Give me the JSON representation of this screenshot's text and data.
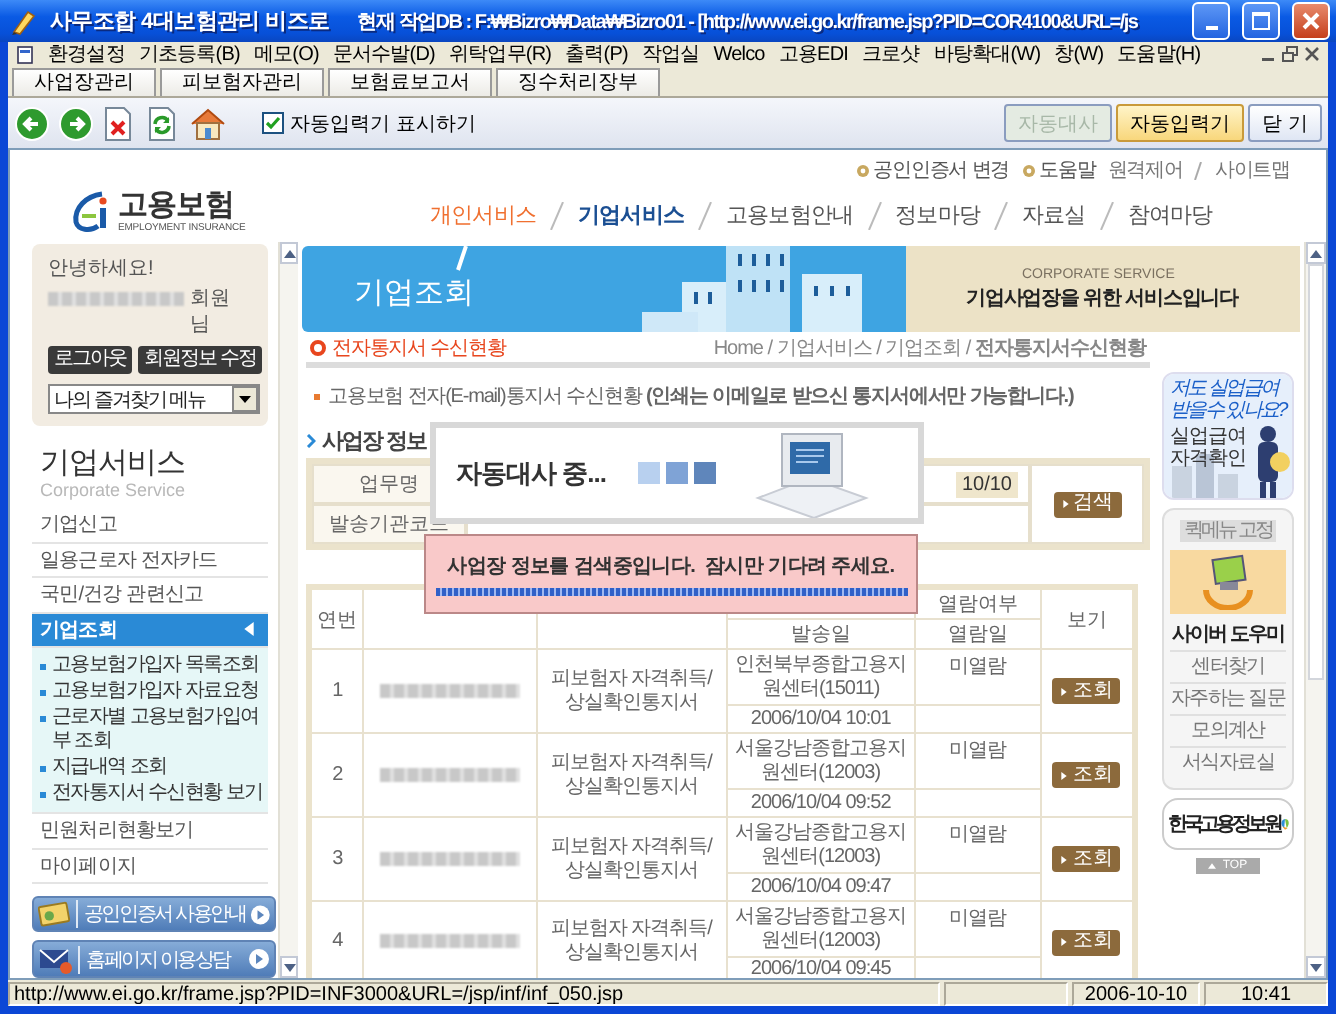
{
  "window": {
    "title": "사무조합 4대보험관리 비즈로",
    "subtitle": "현재 작업DB : F:₩Bizro₩Data₩Bizro01 - [http://www.ei.go.kr/frame.jsp?PID=COR4100&URL=/js"
  },
  "menu": [
    "환경설정",
    "기초등록(B)",
    "메모(O)",
    "문서수발(D)",
    "위탁업무(R)",
    "출력(P)",
    "작업실",
    "Welco",
    "고용EDI",
    "크로샷",
    "바탕확대(W)",
    "창(W)",
    "도움말(H)"
  ],
  "tabs": [
    {
      "label": "사업장관리",
      "selected": false
    },
    {
      "label": "피보험자관리",
      "selected": false
    },
    {
      "label": "보험료보고서",
      "selected": false
    },
    {
      "label": "징수처리장부",
      "selected": false
    }
  ],
  "toolbar": {
    "checkbox": {
      "label": "자동입력기 표시하기",
      "checked": true
    },
    "buttons": [
      {
        "label": "자동대사",
        "disabled": true,
        "highlighted": false
      },
      {
        "label": "자동입력기",
        "disabled": false,
        "highlighted": true
      },
      {
        "label": "닫 기",
        "disabled": false,
        "highlighted": false
      }
    ]
  },
  "site": {
    "top_links": [
      "공인인증서 변경",
      "도움말"
    ],
    "util_links": [
      "원격제어",
      "사이트맵"
    ],
    "logo": {
      "name": "고용보험",
      "subtitle": "EMPLOYMENT INSURANCE"
    },
    "nav": [
      {
        "label": "개인서비스",
        "selected": false,
        "accent": true
      },
      {
        "label": "기업서비스",
        "selected": true,
        "accent": false
      },
      {
        "label": "고용보험안내",
        "selected": false,
        "accent": false
      },
      {
        "label": "정보마당",
        "selected": false,
        "accent": false
      },
      {
        "label": "자료실",
        "selected": false,
        "accent": false
      },
      {
        "label": "참여마당",
        "selected": false,
        "accent": false
      }
    ]
  },
  "sidebar": {
    "login": {
      "greeting": "안녕하세요!",
      "suffix": "회원님",
      "buttons": [
        "로그아웃",
        "회원정보 수정"
      ],
      "favorites": "나의 즐겨찾기 메뉴"
    },
    "title": "기업서비스",
    "subtitle": "Corporate Service",
    "menu": [
      {
        "label": "기업신고",
        "selected": false
      },
      {
        "label": "일용근로자 전자카드",
        "selected": false
      },
      {
        "label": "국민/건강 관련신고",
        "selected": false
      },
      {
        "label": "기업조회",
        "selected": true,
        "children": [
          "고용보험가입자 목록조회",
          "고용보험가입자 자료요청",
          "근로자별 고용보험가입여부 조회",
          "지급내역 조회",
          "전자통지서 수신현황 보기"
        ]
      },
      {
        "label": "민원처리현황보기",
        "selected": false
      },
      {
        "label": "마이페이지",
        "selected": false
      }
    ],
    "buttons": [
      "공인인증서 사용안내",
      "홈페이지 이용상담"
    ]
  },
  "banner": {
    "title": "기업조회",
    "eyebrow": "CORPORATE SERVICE",
    "tagline": "기업사업장을 위한 서비스입니다"
  },
  "page_title": "전자통지서 수신현황",
  "breadcrumb": "Home / 기업서비스 / 기업조회 / **전자통지서수신현황**",
  "notice": "고용보험 전자(E-mail)통지서 수신현황 **(인쇄는 이메일로 받으신 통지서에서만 가능합니다.)**",
  "section_title": "사업장 정보",
  "info_table": {
    "rows": [
      {
        "header": "업무명",
        "value": "10/10"
      },
      {
        "header": "발송기관코드"
      }
    ],
    "button": "검색"
  },
  "table": {
    "header": {
      "number": "연번",
      "sent_date": "발송일",
      "read_status": "열람여부",
      "read_date": "열람일",
      "view": "보기"
    },
    "rows": [
      {
        "number": "1",
        "type": "피보험자 자격취득/상실확인통지서",
        "agency": "인천북부종합고용지원센터(15011)",
        "sent": "2006/10/04 10:01",
        "status": "미열람",
        "button": "조회"
      },
      {
        "number": "2",
        "type": "피보험자 자격취득/상실확인통지서",
        "agency": "서울강남종합고용지원센터(12003)",
        "sent": "2006/10/04 09:52",
        "status": "미열람",
        "button": "조회"
      },
      {
        "number": "3",
        "type": "피보험자 자격취득/상실확인통지서",
        "agency": "서울강남종합고용지원센터(12003)",
        "sent": "2006/10/04 09:47",
        "status": "미열람",
        "button": "조회"
      },
      {
        "number": "4",
        "type": "피보험자 자격취득/상실확인통지서",
        "agency": "서울강남종합고용지원센터(12003)",
        "sent": "2006/10/04 09:45",
        "status": "미열람",
        "button": "조회"
      }
    ]
  },
  "dialog": {
    "title": "자동대사 중...",
    "message": "사업장 정보를 검색중입니다.  잠시만 기다려 주세요.",
    "level": 1
  },
  "quick_menu": {
    "ad_question": "저도 실업급여 받을수 있나요?",
    "ad_title": "실업급여 자격확인",
    "pin_label": "퀵메뉴 고정",
    "title": "사이버 도우미",
    "links": [
      "센터찾기",
      "자주하는 질문",
      "모의계산",
      "서식자료실"
    ],
    "partner": "한국고용정보원",
    "top": "TOP"
  },
  "status_bar": {
    "url": "http://www.ei.go.kr/frame.jsp?PID=INF3000&URL=/jsp/inf/inf_050.jsp",
    "date": "2006-10-10",
    "time": "10:41"
  }
}
